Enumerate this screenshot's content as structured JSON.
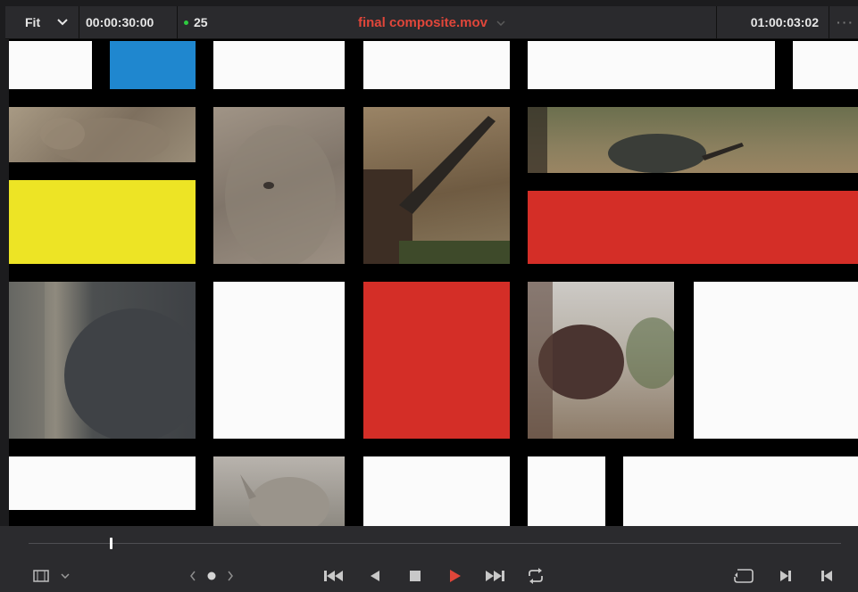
{
  "topbar": {
    "zoom_label": "Fit",
    "zoom_chevron": "chevron-down-icon",
    "duration_timecode": "00:00:30:00",
    "fps": "25",
    "clip_title": "final composite.mov",
    "current_timecode": "01:00:03:02",
    "more_glyph": "···"
  },
  "viewer": {
    "tile_colors": {
      "white": "#fbfbfb",
      "blue": "#1f87cf",
      "yellow": "#ede425",
      "red": "#d42e27",
      "grid": "#000000"
    }
  },
  "transport": {
    "scrub_position": 0.1,
    "accent_color": "#e0463a",
    "buttons": [
      "previous-clip-icon",
      "reverse-play-icon",
      "stop-icon",
      "play-icon",
      "next-clip-icon",
      "loop-icon"
    ]
  }
}
